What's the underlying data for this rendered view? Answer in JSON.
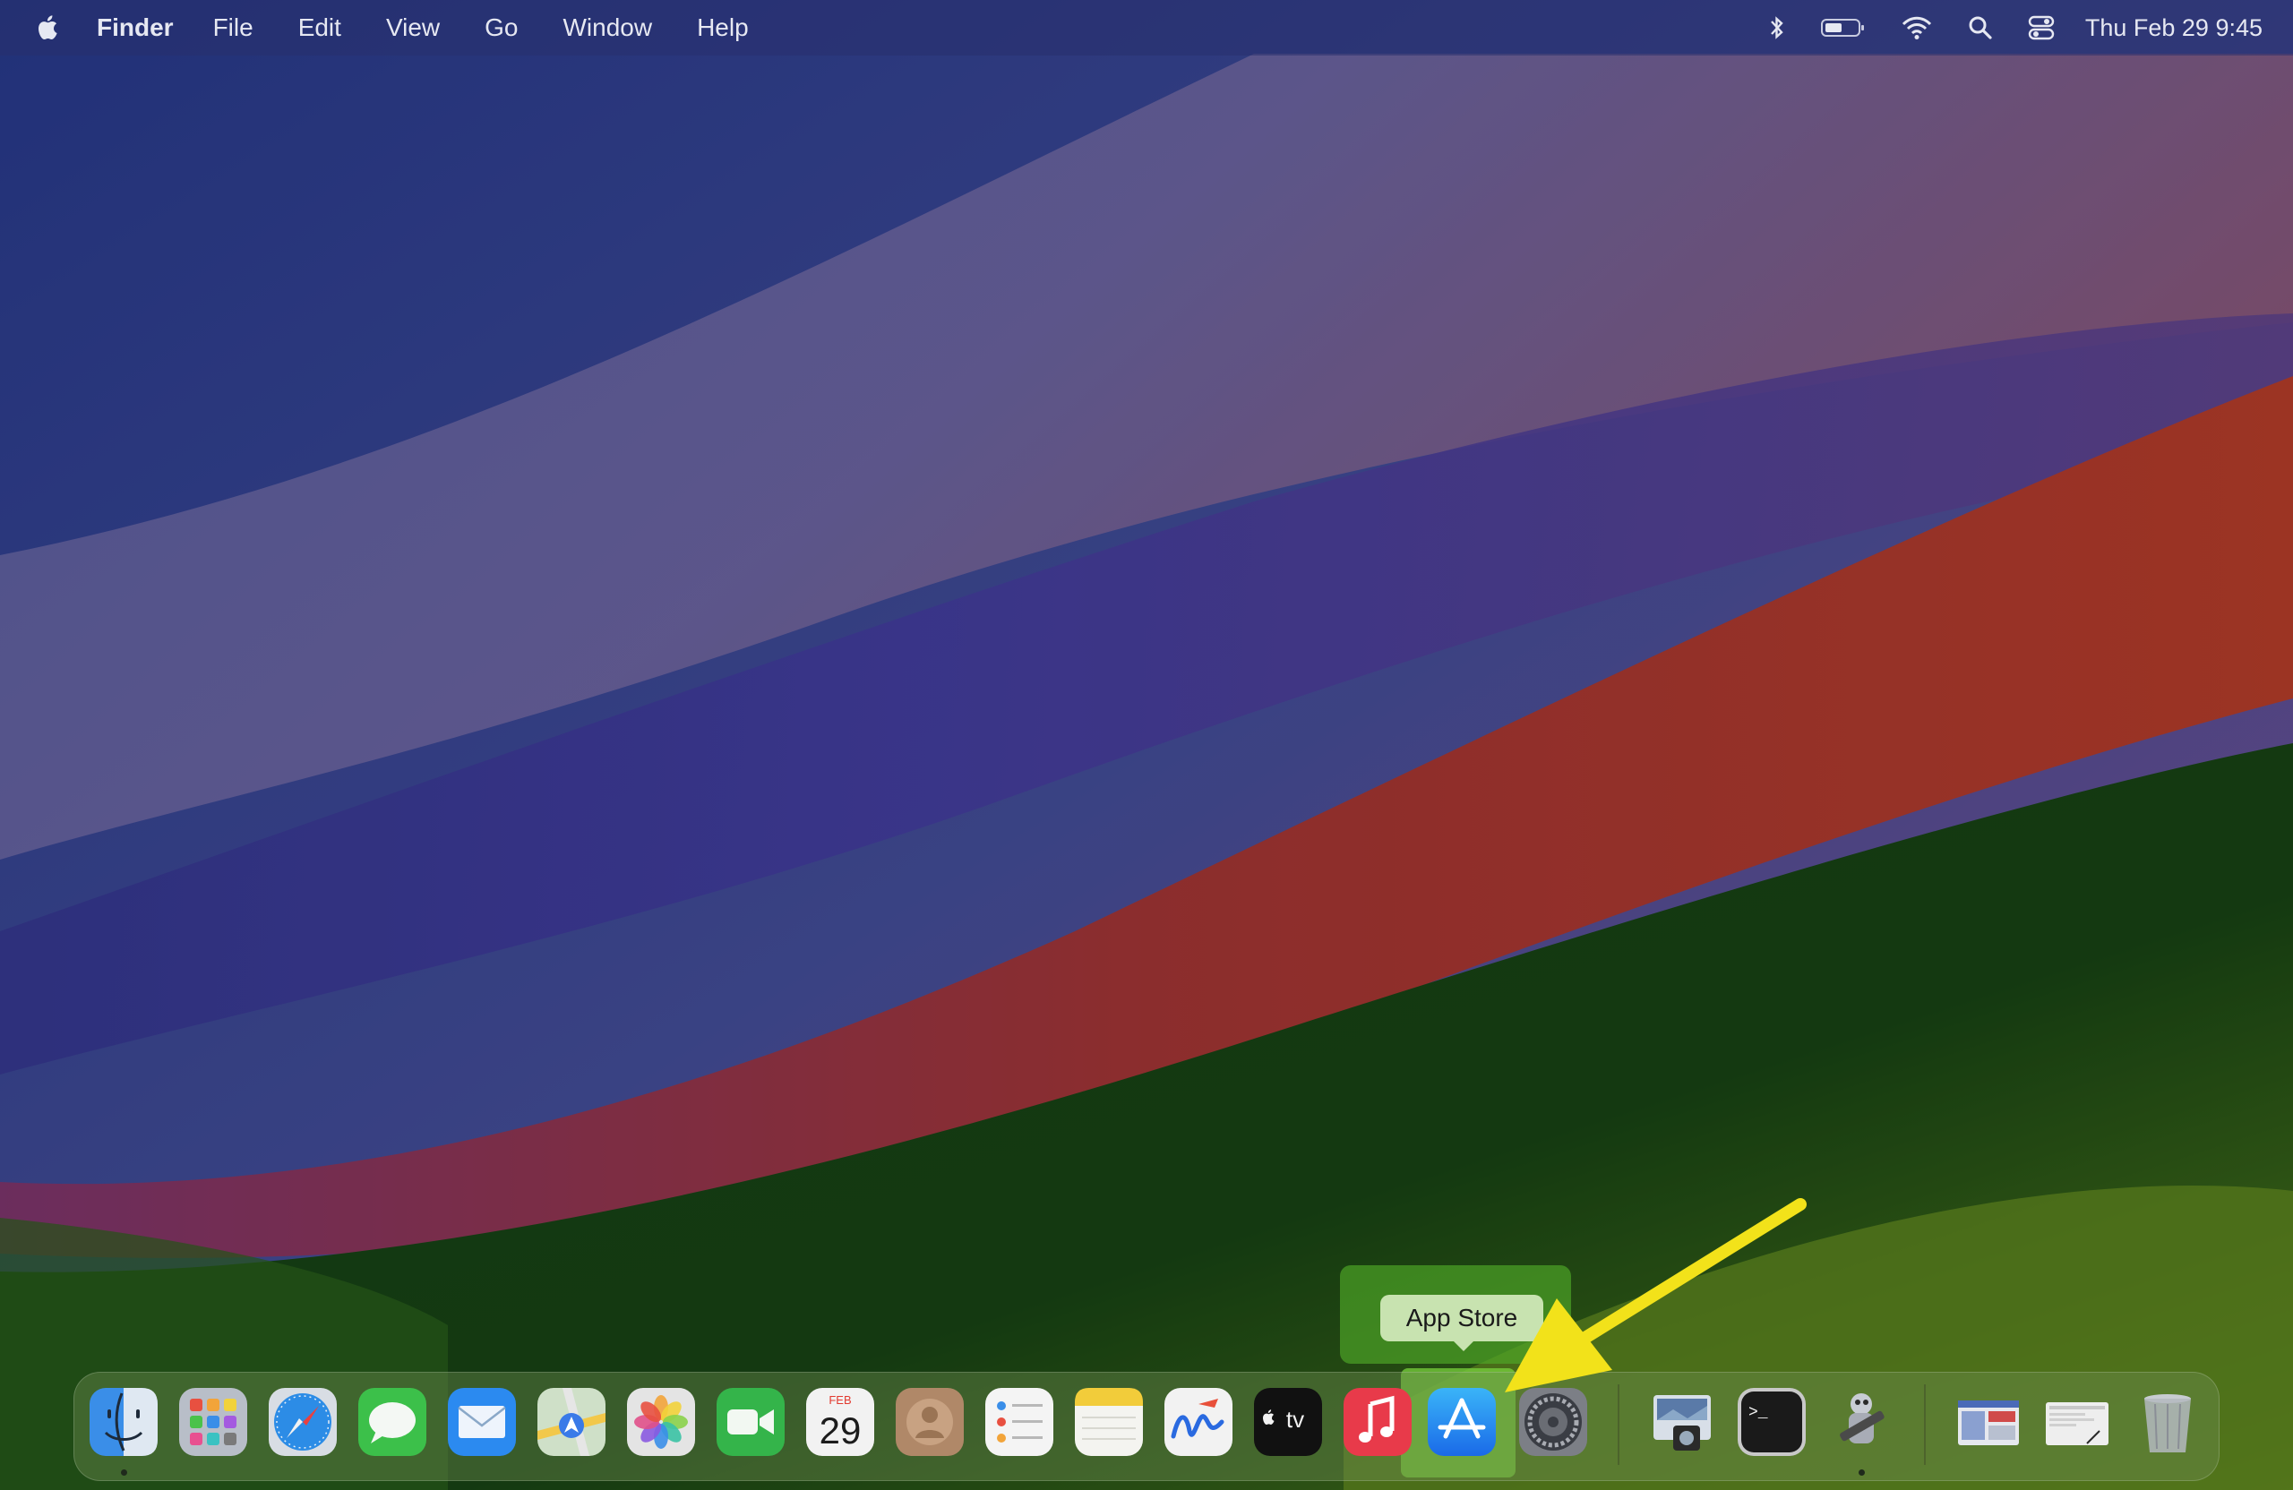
{
  "menubar": {
    "app_name": "Finder",
    "menus": [
      "File",
      "Edit",
      "View",
      "Go",
      "Window",
      "Help"
    ],
    "clock": "Thu Feb 29  9:45",
    "status_icons": [
      "bluetooth-icon",
      "battery-icon",
      "wifi-icon",
      "spotlight-icon",
      "control-center-icon"
    ]
  },
  "dock": {
    "apps": [
      {
        "name": "Finder",
        "icon": "finder-icon",
        "running": true
      },
      {
        "name": "Launchpad",
        "icon": "launchpad-icon",
        "running": false
      },
      {
        "name": "Safari",
        "icon": "safari-icon",
        "running": false
      },
      {
        "name": "Messages",
        "icon": "messages-icon",
        "running": false
      },
      {
        "name": "Mail",
        "icon": "mail-icon",
        "running": false
      },
      {
        "name": "Maps",
        "icon": "maps-icon",
        "running": false
      },
      {
        "name": "Photos",
        "icon": "photos-icon",
        "running": false
      },
      {
        "name": "FaceTime",
        "icon": "facetime-icon",
        "running": false
      },
      {
        "name": "Calendar",
        "icon": "calendar-icon",
        "running": false
      },
      {
        "name": "Contacts",
        "icon": "contacts-icon",
        "running": false
      },
      {
        "name": "Reminders",
        "icon": "reminders-icon",
        "running": false
      },
      {
        "name": "Notes",
        "icon": "notes-icon",
        "running": false
      },
      {
        "name": "Freeform",
        "icon": "freeform-icon",
        "running": false
      },
      {
        "name": "TV",
        "icon": "apple-tv-icon",
        "running": false
      },
      {
        "name": "Music",
        "icon": "music-icon",
        "running": false
      },
      {
        "name": "App Store",
        "icon": "app-store-icon",
        "running": false
      },
      {
        "name": "System Settings",
        "icon": "system-settings-icon",
        "running": false
      },
      {
        "name": "Preview",
        "icon": "preview-icon",
        "running": false
      },
      {
        "name": "Terminal",
        "icon": "terminal-icon",
        "running": false
      },
      {
        "name": "Automator",
        "icon": "automator-icon",
        "running": true
      },
      {
        "name": "Downloads",
        "icon": "downloads-stack-icon",
        "running": false
      },
      {
        "name": "Documents",
        "icon": "documents-stack-icon",
        "running": false
      },
      {
        "name": "Trash",
        "icon": "trash-icon",
        "running": false
      }
    ],
    "calendar": {
      "month": "FEB",
      "day": "29"
    },
    "tv_label": "tv",
    "terminal_prompt": ">_"
  },
  "tooltip": {
    "label": "App Store"
  },
  "colors": {
    "accent_arrow": "#f2e21a",
    "highlight": "#7ad23c"
  }
}
